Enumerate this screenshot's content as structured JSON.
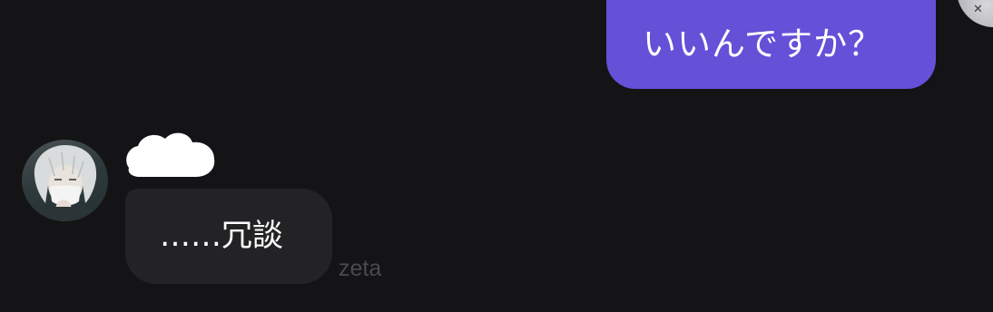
{
  "conversation": {
    "messages": [
      {
        "role": "user",
        "text": "いいんですか？"
      },
      {
        "role": "character",
        "text": "……冗談"
      }
    ],
    "model_label": "zeta"
  },
  "colors": {
    "background": "#141416",
    "user_bubble": "#6550d8",
    "character_bubble": "#232325",
    "model_label": "#4a4a4f"
  },
  "icons": {
    "self_avatar": "user-avatar-icon",
    "character_avatar": "character-avatar-icon",
    "name_redaction": "redaction-blob"
  }
}
